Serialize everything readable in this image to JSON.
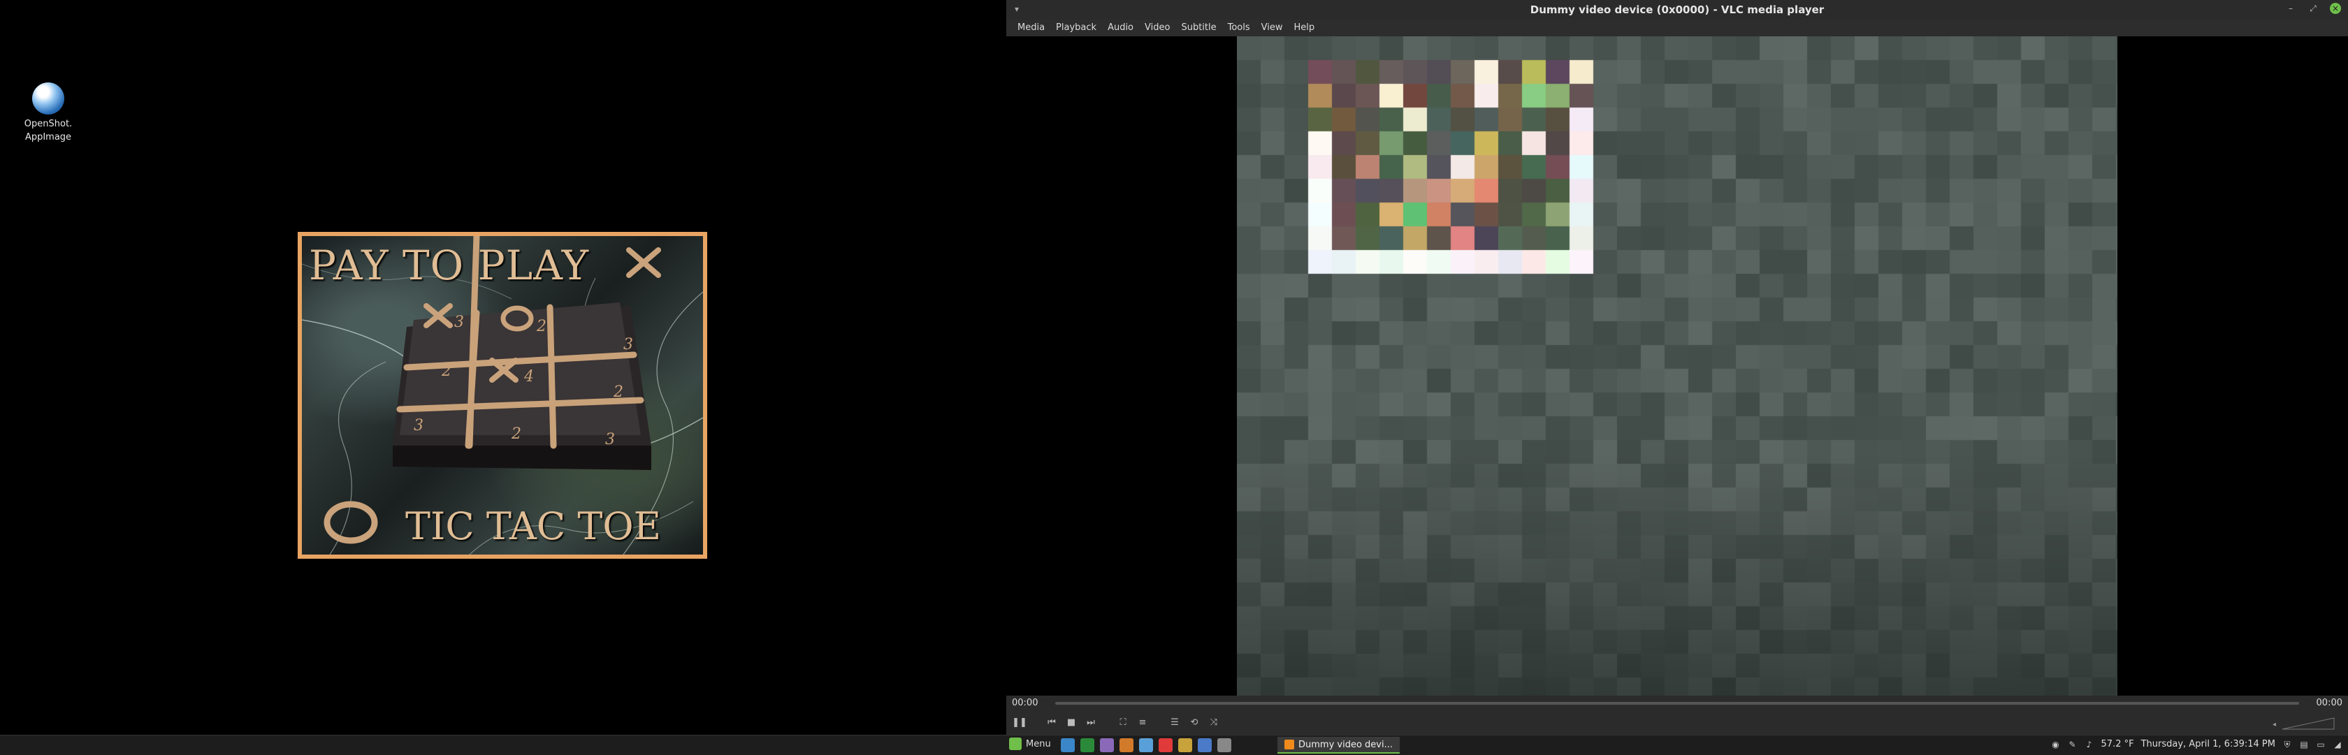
{
  "desktop": {
    "icon_label_line1": "OpenShot.",
    "icon_label_line2": "AppImage"
  },
  "game_image": {
    "title_top": "PAY TO PLAY",
    "title_bottom": "TIC TAC TOE",
    "accent": "#e8a462",
    "cells": [
      "X 3",
      "O 2",
      "3",
      "2",
      "X 4",
      "2",
      "3",
      "2",
      "3"
    ]
  },
  "vlc": {
    "title": "Dummy video device (0x0000) - VLC media player",
    "menu": [
      "Media",
      "Playback",
      "Audio",
      "Video",
      "Subtitle",
      "Tools",
      "View",
      "Help"
    ],
    "time_elapsed": "00:00",
    "time_total": "00:00",
    "controls": [
      "pause-icon",
      "previous-icon",
      "stop-icon",
      "next-icon",
      "fullscreen-icon",
      "extended-settings-icon",
      "playlist-icon",
      "loop-icon",
      "shuffle-icon"
    ]
  },
  "taskbar": {
    "menu_label": "Menu",
    "task_label": "Dummy video devi...",
    "weather": "57.2 °F",
    "clock": "Thursday, April 1, 6:39:14 PM",
    "launchers": [
      "#3a86c8",
      "#2a8a3a",
      "#8a6ab8",
      "#d07a2a",
      "#5aa0d8",
      "#e03a3a",
      "#c8a23a",
      "#4a7ac8",
      "#888888"
    ]
  }
}
